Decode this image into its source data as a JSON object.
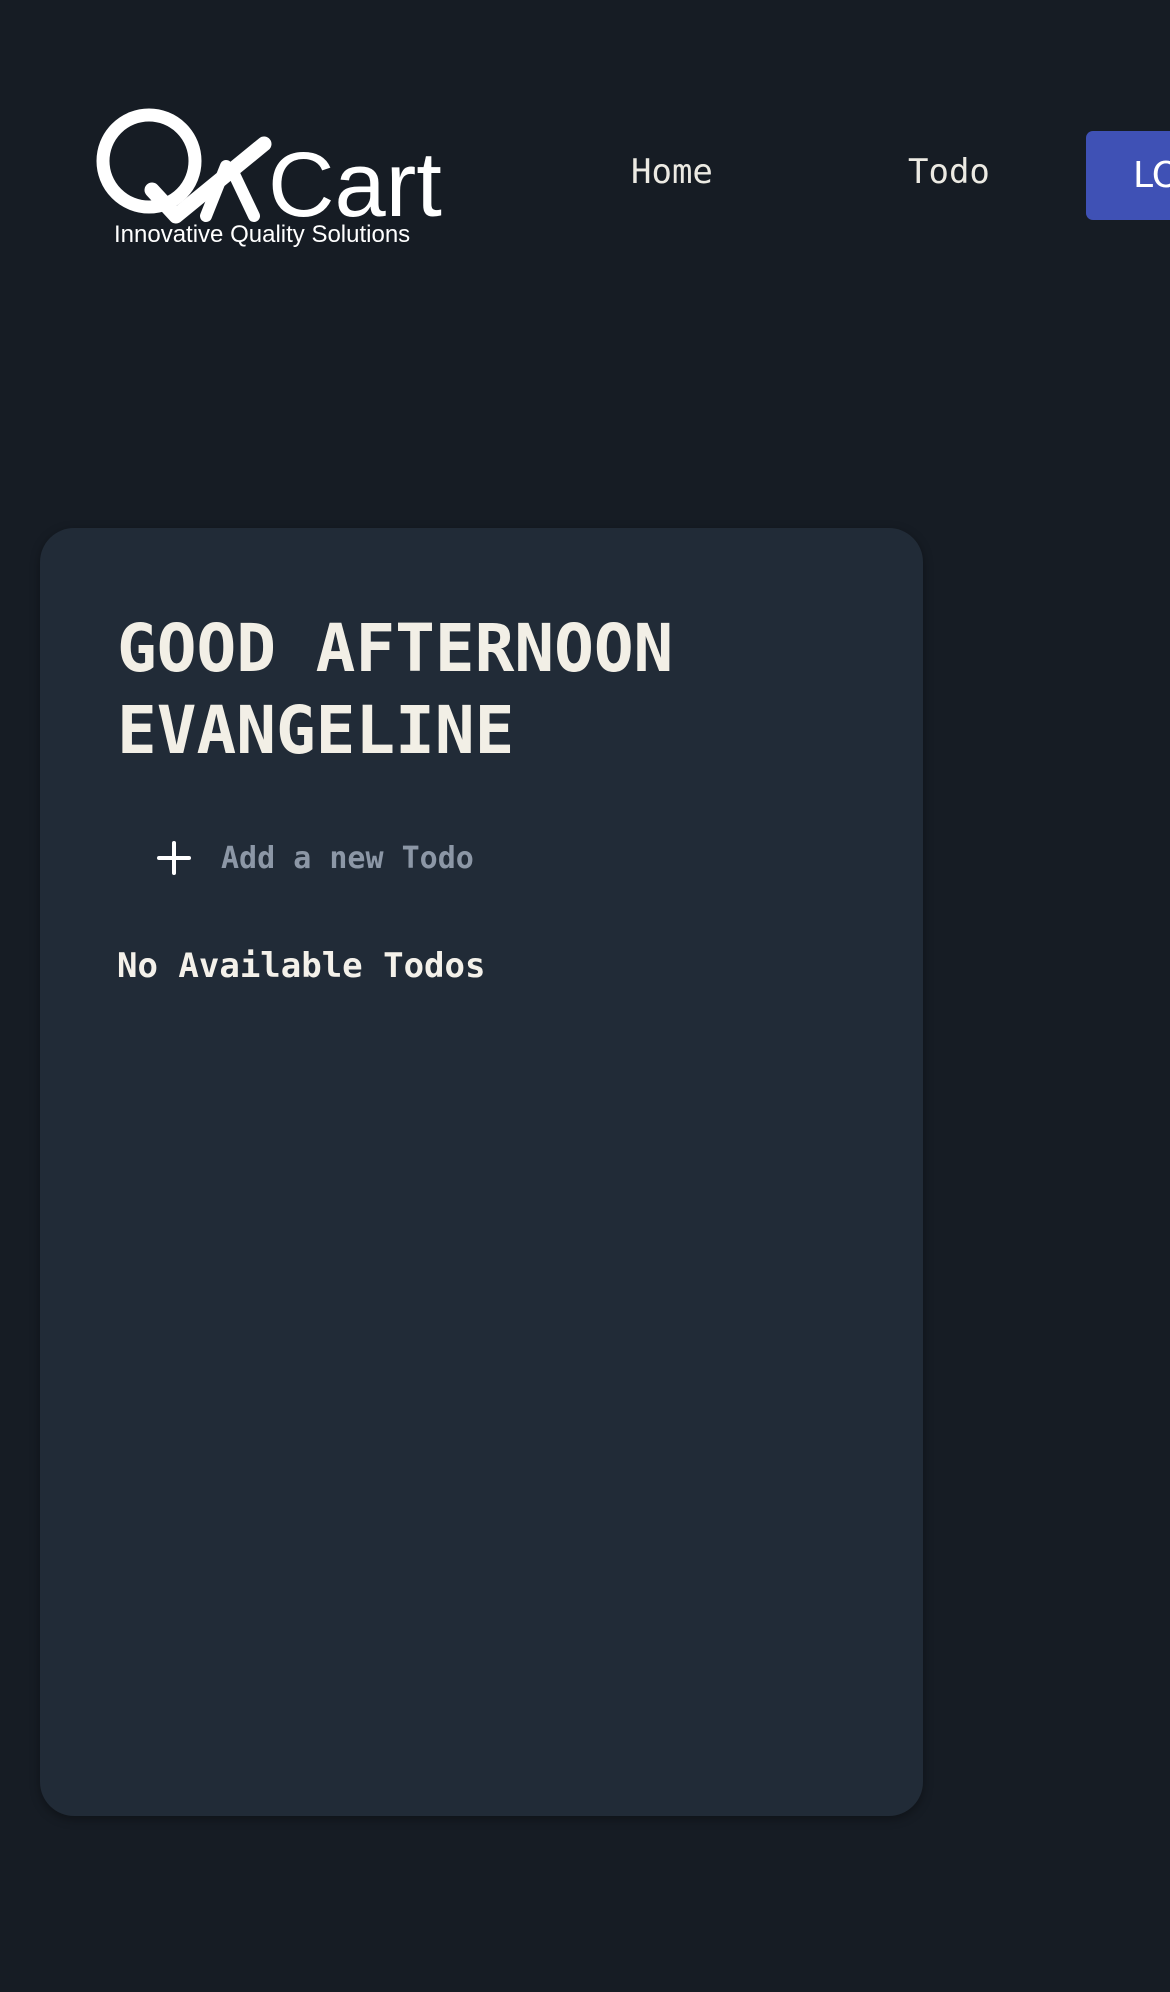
{
  "brand": {
    "logo_text": "QA Cart",
    "tagline": "Innovative Quality Solutions"
  },
  "nav": {
    "items": [
      {
        "label": "Home"
      },
      {
        "label": "Todo"
      }
    ],
    "logout_label": "LOGOUT"
  },
  "main": {
    "greeting_line1": "GOOD AFTERNOON",
    "greeting_line2": "EVANGELINE",
    "add_todo": {
      "placeholder": "Add a new Todo",
      "icon": "plus-icon"
    },
    "empty_message": "No Available Todos"
  },
  "colors": {
    "background": "#161c24",
    "card": "#212b37",
    "accent": "#3f51b5",
    "text": "#f2efe6",
    "placeholder": "#8c97a6"
  }
}
